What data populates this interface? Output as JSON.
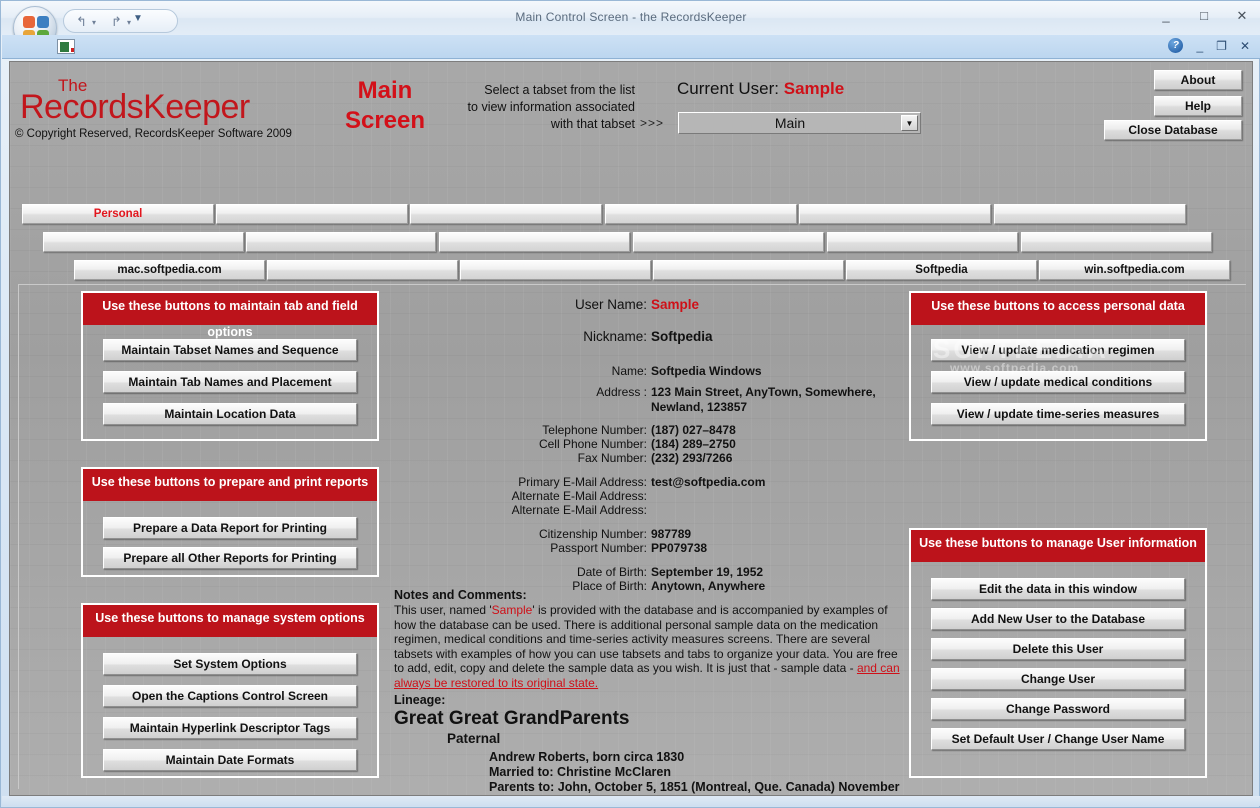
{
  "window": {
    "title": "Main Control Screen - the RecordsKeeper",
    "minimize": "_",
    "maximize": "□",
    "close": "✕",
    "doc_minimize": "_",
    "doc_restore": "❐",
    "doc_close": "✕",
    "help_glyph": "?",
    "qat": {
      "undo": "↰",
      "redo": "↱",
      "dropdown": "▾",
      "more": "▼"
    }
  },
  "brand": {
    "the": "The",
    "name": "RecordsKeeper",
    "copyright": "© Copyright Reserved, RecordsKeeper Software  2009",
    "screen_title_line1": "Main",
    "screen_title_line2": "Screen"
  },
  "header": {
    "tabset_hint_line1": "Select a tabset from the list",
    "tabset_hint_line2": "to view information associated",
    "tabset_hint_line3": "with that tabset",
    "arrows": ">>>",
    "current_user_label": "Current User:",
    "current_user_value": "Sample",
    "tabset_selected": "Main",
    "tabset_arrow": "▼",
    "about": "About",
    "help": "Help",
    "close_database": "Close Database"
  },
  "tab_rows": {
    "row1": [
      "Personal",
      "",
      "",
      "",
      "",
      ""
    ],
    "row2": [
      "",
      "",
      "",
      "",
      "",
      ""
    ],
    "row3": [
      "mac.softpedia.com",
      "",
      "",
      "",
      "Softpedia",
      "win.softpedia.com"
    ]
  },
  "panels": {
    "tab_field_options": {
      "header": "Use these buttons to maintain tab and field options",
      "buttons": [
        "Maintain Tabset Names and Sequence",
        "Maintain Tab Names and Placement",
        "Maintain Location Data"
      ]
    },
    "reports": {
      "header": "Use these buttons to prepare and print reports",
      "buttons": [
        "Prepare a Data Report for Printing",
        "Prepare all Other Reports for Printing"
      ]
    },
    "system_options": {
      "header": "Use these buttons to manage system options",
      "buttons": [
        "Set System Options",
        "Open the Captions Control Screen",
        "Maintain Hyperlink Descriptor Tags",
        "Maintain Date Formats"
      ]
    },
    "personal_data": {
      "header": "Use these buttons to access personal data",
      "buttons": [
        "View / update medication regimen",
        "View / update medical conditions",
        "View / update time-series measures"
      ]
    },
    "user_information": {
      "header": "Use these buttons to manage User information",
      "buttons": [
        "Edit the data in this window",
        "Add New User to the Database",
        "Delete this User",
        "Change User",
        "Change Password",
        "Set Default User / Change User Name"
      ]
    }
  },
  "user_fields": [
    {
      "label": "User Name:",
      "value": "Sample"
    },
    {
      "label": "Nickname:",
      "value": "Softpedia"
    },
    {
      "label": "Name:",
      "value": "Softpedia  Windows"
    },
    {
      "label": "Address :",
      "value": "123 Main Street, AnyTown, Somewhere,"
    },
    {
      "label": "",
      "value": "Newland, 123857"
    },
    {
      "label": "Telephone Number:",
      "value": "(187) 027–8478"
    },
    {
      "label": "Cell Phone Number:",
      "value": "(184) 289–2750"
    },
    {
      "label": "Fax Number:",
      "value": "(232) 293/7266"
    },
    {
      "label": "Primary E-Mail Address:",
      "value": "test@softpedia.com"
    },
    {
      "label": "Alternate E-Mail Address:",
      "value": ""
    },
    {
      "label": "Alternate E-Mail Address:",
      "value": ""
    },
    {
      "label": "Citizenship Number:",
      "value": "987789"
    },
    {
      "label": "Passport Number:",
      "value": "PP079738"
    },
    {
      "label": "Date of Birth:",
      "value": "September 19, 1952"
    },
    {
      "label": "Place of Birth:",
      "value": "Anytown, Anywhere"
    }
  ],
  "notes": {
    "title": "Notes and Comments:",
    "text_part1": "This user, named '",
    "quoted": "Sample",
    "text_part2": "' is provided with the database and is accompanied by examples of how the database can be used. There is additional personal sample data on the medication regimen, medical conditions and time-series activity measures screens. There are several tabsets with examples of how you can use tabsets and tabs to organize your data. You are free to add, edit, copy and delete the sample data as you wish. It is just that - sample data - ",
    "underlined": "and can always be restored to its original state."
  },
  "lineage": {
    "title": "Lineage:",
    "heading": "Great Great GrandParents",
    "subheading": "Paternal",
    "lines": [
      "Andrew Roberts, born circa 1830",
      "Married to: Christine McClaren",
      "Parents to: John, October 5, 1851 (Montreal, Que. Canada) November"
    ]
  },
  "watermark": {
    "line1": "SOFTPEDIA",
    "line2": "www.softpedia.com"
  }
}
